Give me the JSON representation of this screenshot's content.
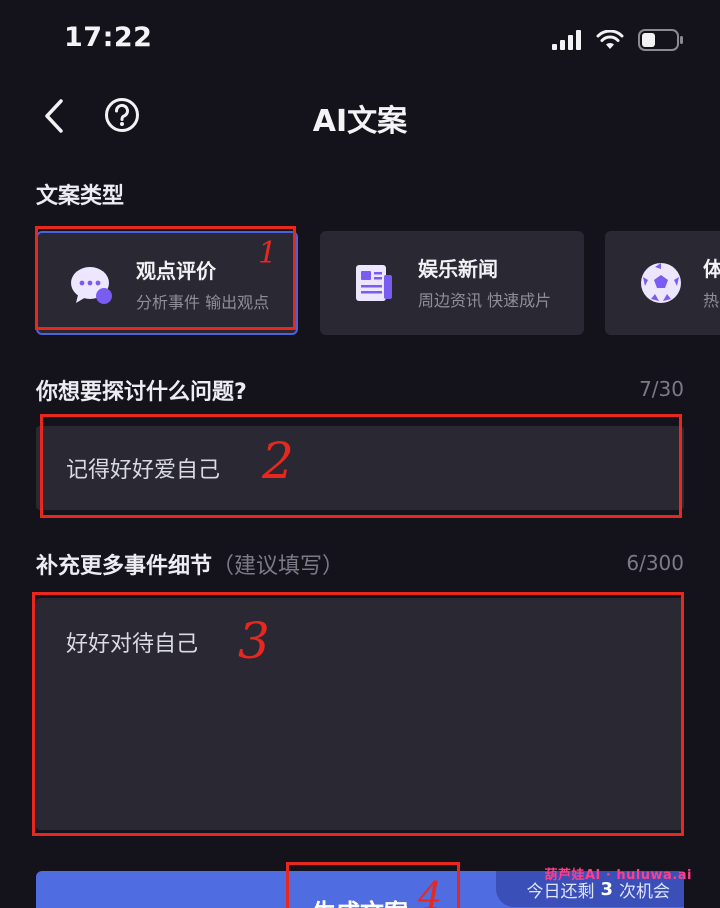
{
  "status_bar": {
    "time": "17:22"
  },
  "header": {
    "title": "AI文案",
    "back_icon": "chevron-left-icon",
    "help_icon": "question-circle-icon"
  },
  "copy_type": {
    "label": "文案类型",
    "cards": [
      {
        "title": "观点评价",
        "subtitle": "分析事件 输出观点",
        "icon": "chat-bubble-icon",
        "selected": true
      },
      {
        "title": "娱乐新闻",
        "subtitle": "周边资讯 快速成片",
        "icon": "newspaper-icon",
        "selected": false
      },
      {
        "title": "体",
        "subtitle": "热",
        "icon": "soccer-ball-icon",
        "selected": false
      }
    ]
  },
  "topic": {
    "label": "你想要探讨什么问题?",
    "counter": "7/30",
    "value": "记得好好爱自己"
  },
  "details": {
    "label": "补充更多事件细节",
    "hint": "（建议填写）",
    "counter": "6/300",
    "value": "好好对待自己"
  },
  "generate": {
    "label": "生成文案",
    "chances_prefix": "今日还剩",
    "chances_count": "3",
    "chances_suffix": "次机会"
  },
  "annotations": [
    "1",
    "2",
    "3",
    "4"
  ],
  "watermark": "葫芦娃AI · huluwa.ai",
  "colors": {
    "background": "#14131c",
    "card": "#2a2933",
    "accent": "#4f6ce0",
    "annotation": "#e8281e"
  }
}
